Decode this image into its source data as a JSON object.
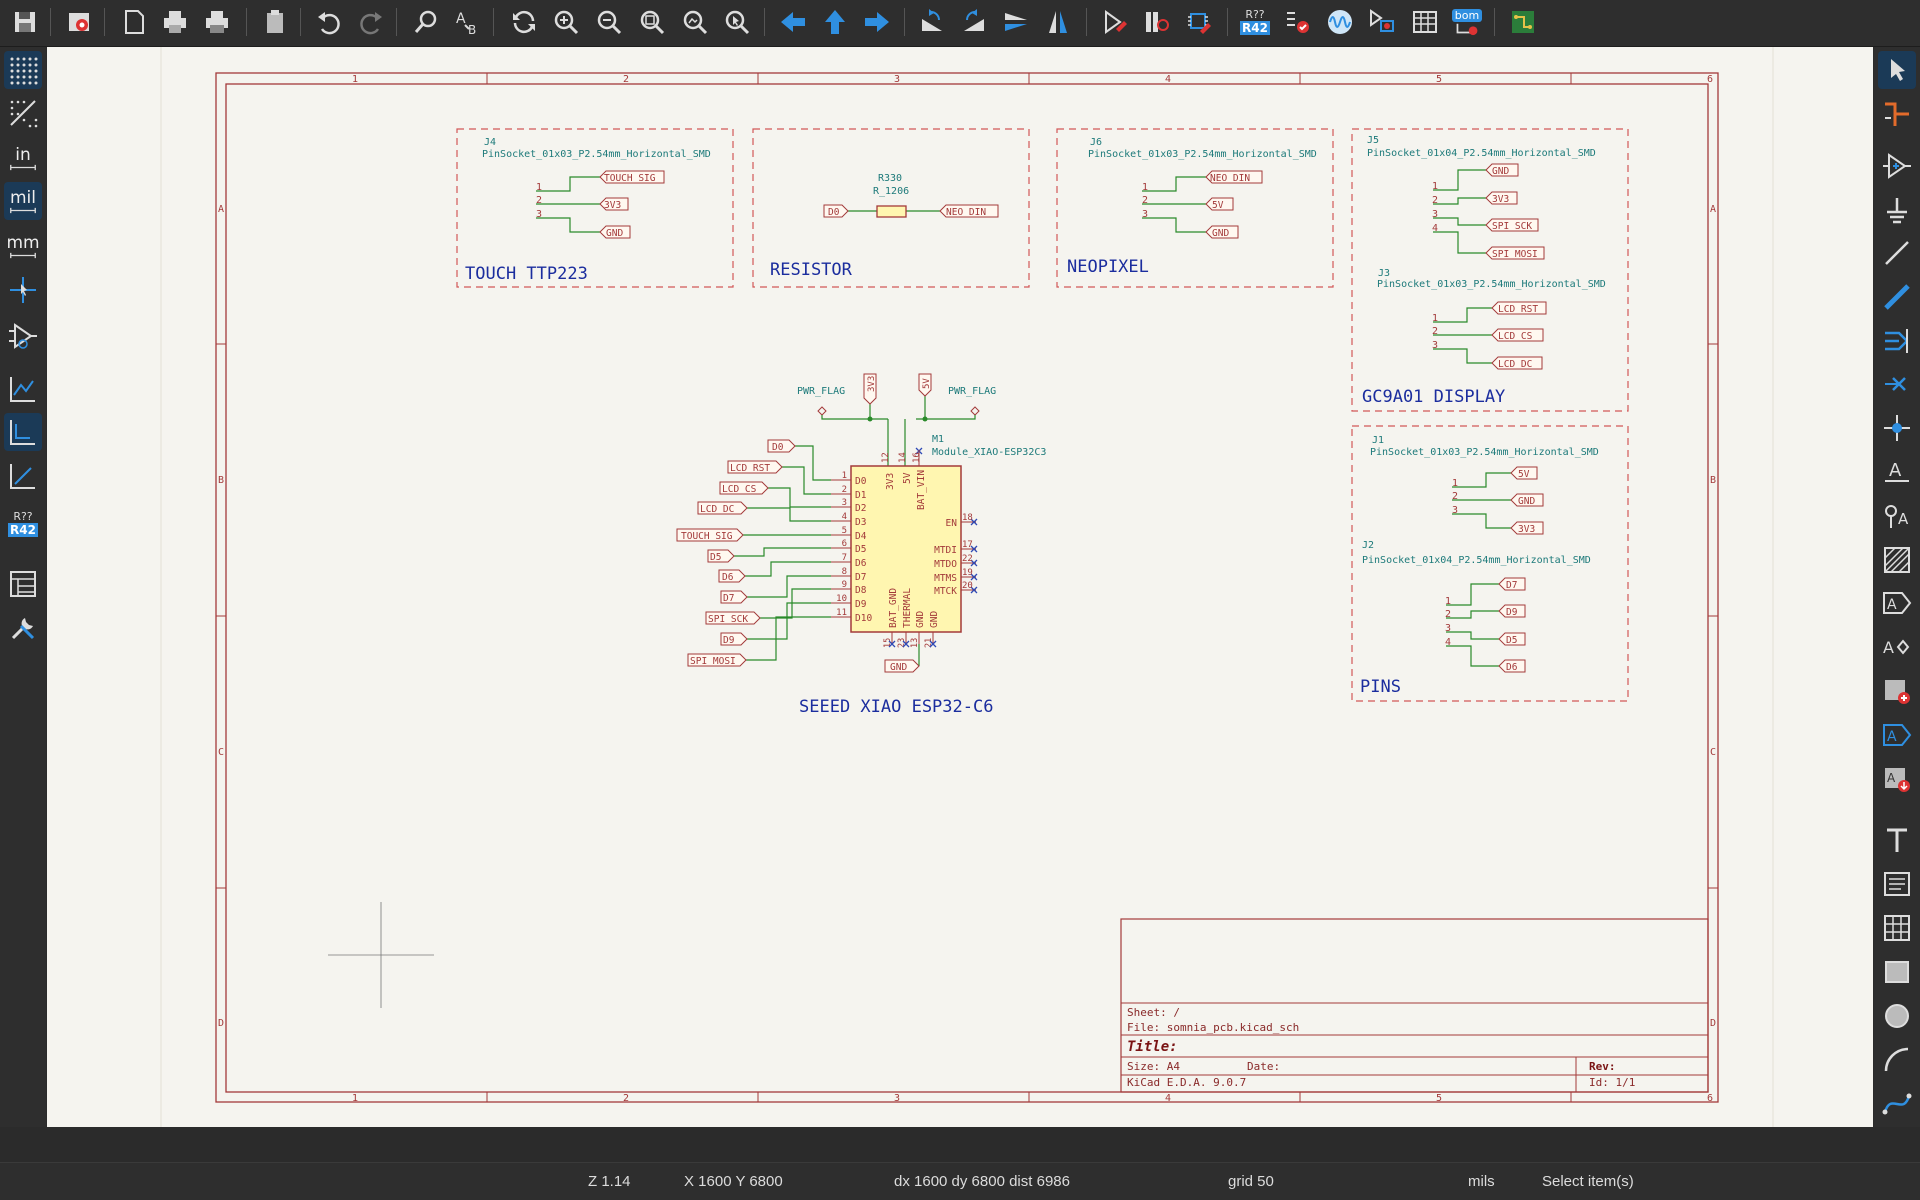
{
  "status": {
    "zoom": "Z 1.14",
    "cursor": "X 1600  Y 6800",
    "delta": "dx 1600  dy 6800  dist 6986",
    "grid": "grid 50",
    "units": "mils",
    "mode": "Select item(s)"
  },
  "left_toolbar": {
    "in_label": "in",
    "mil_label": "mil",
    "mm_label": "mm",
    "r42_top": "R??",
    "r42_bottom": "R42"
  },
  "top_toolbar": {
    "annotate_top": "R??",
    "annotate_bottom": "R42",
    "bom_label": "bom"
  },
  "sheet": {
    "col_labels": [
      "1",
      "2",
      "3",
      "4",
      "5",
      "6"
    ],
    "row_labels": [
      "A",
      "B",
      "C",
      "D"
    ]
  },
  "title_block": {
    "sheet": "Sheet: /",
    "file": "File: somnia_pcb.kicad_sch",
    "title": "Title:",
    "size": "Size: A4",
    "date": "Date:",
    "rev": "Rev:",
    "tool": "KiCad E.D.A. 9.0.7",
    "id": "Id: 1/1"
  },
  "blocks": {
    "touch": {
      "title": "TOUCH TTP223",
      "ref": "J4",
      "value": "PinSocket_01x03_P2.54mm_Horizontal_SMD",
      "pins": [
        "1",
        "2",
        "3"
      ],
      "nets": [
        "TOUCH_SIG",
        "3V3",
        "GND"
      ]
    },
    "resistor": {
      "title": "RESISTOR",
      "ref": "R330",
      "value": "R_1206",
      "left_net": "D0",
      "right_net": "NEO_DIN"
    },
    "neopixel": {
      "title": "NEOPIXEL",
      "ref": "J6",
      "value": "PinSocket_01x03_P2.54mm_Horizontal_SMD",
      "pins": [
        "1",
        "2",
        "3"
      ],
      "nets": [
        "NEO_DIN",
        "5V",
        "GND"
      ]
    },
    "display": {
      "title": "GC9A01 DISPLAY",
      "j5_ref": "J5",
      "j5_value": "PinSocket_01x04_P2.54mm_Horizontal_SMD",
      "j5_pins": [
        "1",
        "2",
        "3",
        "4"
      ],
      "j5_nets": [
        "GND",
        "3V3",
        "SPI_SCK",
        "SPI_MOSI"
      ],
      "j3_ref": "J3",
      "j3_value": "PinSocket_01x03_P2.54mm_Horizontal_SMD",
      "j3_pins": [
        "1",
        "2",
        "3"
      ],
      "j3_nets": [
        "LCD_RST",
        "LCD_CS",
        "LCD_DC"
      ]
    },
    "pins_block": {
      "title": "PINS",
      "j1_ref": "J1",
      "j1_value": "PinSocket_01x03_P2.54mm_Horizontal_SMD",
      "j1_pins": [
        "1",
        "2",
        "3"
      ],
      "j1_nets": [
        "5V",
        "GND",
        "3V3"
      ],
      "j2_ref": "J2",
      "j2_value": "PinSocket_01x04_P2.54mm_Horizontal_SMD",
      "j2_pins": [
        "1",
        "2",
        "3",
        "4"
      ],
      "j2_nets": [
        "D7",
        "D9",
        "D5",
        "D6"
      ]
    },
    "mcu": {
      "title": "SEEED XIAO ESP32-C6",
      "ref": "M1",
      "value": "Module_XIAO-ESP32C3",
      "pwr_flag_left": "PWR_FLAG",
      "pwr_flag_right": "PWR_FLAG",
      "top_nets": [
        "3V3",
        "5V"
      ],
      "gnd_net": "GND",
      "left_nets": [
        "D0",
        "LCD_RST",
        "LCD_CS",
        "LCD_DC",
        "TOUCH_SIG",
        "D5",
        "D6",
        "D7",
        "SPI_SCK",
        "D9",
        "SPI_MOSI"
      ],
      "left_pin_nums": [
        "1",
        "2",
        "3",
        "4",
        "5",
        "6",
        "7",
        "8",
        "9",
        "10",
        "11"
      ],
      "left_pin_names": [
        "D0",
        "D1",
        "D2",
        "D3",
        "D4",
        "D5",
        "D6",
        "D7",
        "D8",
        "D9",
        "D10"
      ],
      "top_pins": [
        "3V3",
        "5V",
        "BAT_VIN"
      ],
      "top_pin_nums": [
        "12",
        "14",
        "16"
      ],
      "right_pins": [
        "EN",
        "MTDI",
        "MTDO",
        "MTMS",
        "MTCK"
      ],
      "right_pin_nums": [
        "18",
        "17",
        "22",
        "19",
        "20"
      ],
      "bottom_pins": [
        "BAT_GND",
        "THERMAL",
        "GND",
        "GND"
      ],
      "bottom_pin_nums": [
        "15",
        "23",
        "13",
        "21"
      ]
    }
  }
}
